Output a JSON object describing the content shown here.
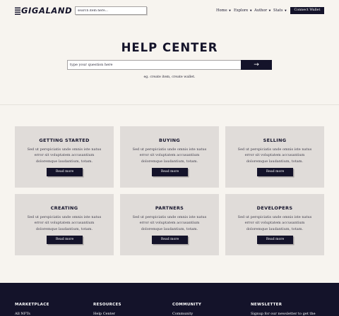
{
  "header": {
    "logo": "GIGALAND",
    "search_placeholder": "search item here...",
    "nav": [
      {
        "label": "Home"
      },
      {
        "label": "Explore"
      },
      {
        "label": "Author"
      },
      {
        "label": "Stats"
      }
    ],
    "connect_label": "Connect Wallet"
  },
  "hero": {
    "title": "HELP CENTER",
    "input_placeholder": "type your question here",
    "submit_icon": "→",
    "hint": "eg. create item, create wallet."
  },
  "cards": [
    {
      "title": "GETTING STARTED",
      "text": "Sed ut perspiciatis unde omnis iste natus error sit voluptatem accusantium doloremque laudantium, totam.",
      "button": "Read more"
    },
    {
      "title": "BUYING",
      "text": "Sed ut perspiciatis unde omnis iste natus error sit voluptatem accusantium doloremque laudantium, totam.",
      "button": "Read more"
    },
    {
      "title": "SELLING",
      "text": "Sed ut perspiciatis unde omnis iste natus error sit voluptatem accusantium doloremque laudantium, totam.",
      "button": "Read more"
    },
    {
      "title": "CREATING",
      "text": "Sed ut perspiciatis unde omnis iste natus error sit voluptatem accusantium doloremque laudantium, totam.",
      "button": "Read more"
    },
    {
      "title": "PARTNERS",
      "text": "Sed ut perspiciatis unde omnis iste natus error sit voluptatem accusantium doloremque laudantium, totam.",
      "button": "Read more"
    },
    {
      "title": "DEVELOPERS",
      "text": "Sed ut perspiciatis unde omnis iste natus error sit voluptatem accusantium doloremque laudantium, totam.",
      "button": "Read more"
    }
  ],
  "footer": {
    "columns": [
      {
        "heading": "MARKETPLACE",
        "first_link": "All NFTs"
      },
      {
        "heading": "RESOURCES",
        "first_link": "Help Center"
      },
      {
        "heading": "COMMUNITY",
        "first_link": "Community"
      },
      {
        "heading": "NEWSLETTER",
        "first_link": "Signup for our newsletter to get the"
      }
    ]
  },
  "colors": {
    "page_background": "#f7f4ef",
    "primary_dark": "#14132a",
    "card_background": "#e0dcd9"
  }
}
